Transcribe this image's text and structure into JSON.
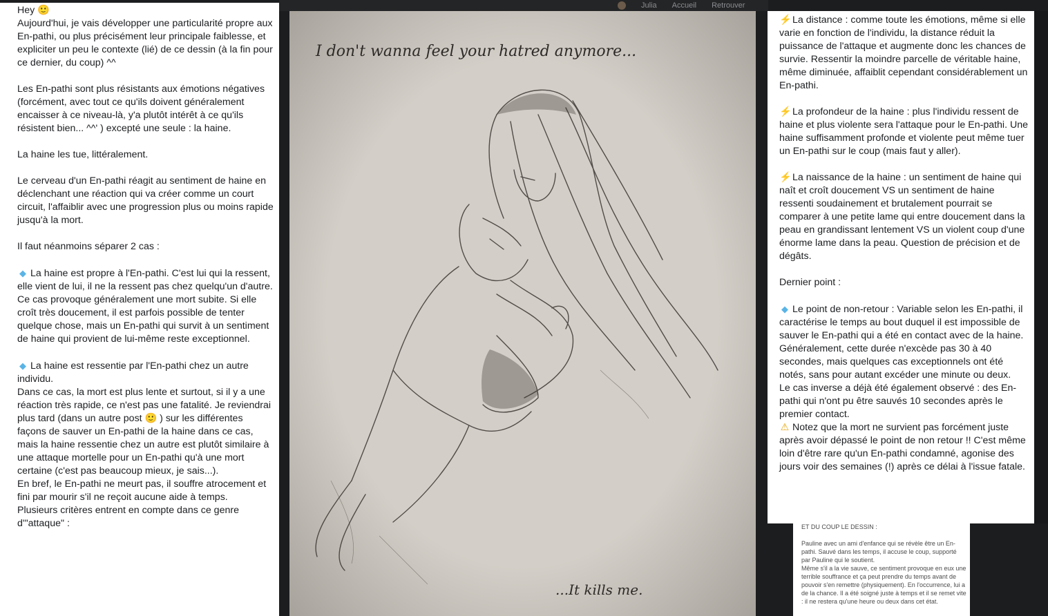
{
  "topbar": {
    "user": "Julia",
    "home": "Accueil",
    "other": "Retrouver"
  },
  "left": {
    "p1": "Hey 🙂\nAujourd'hui, je vais développer une particularité propre aux En-pathi, ou plus précisément leur principale faiblesse, et expliciter un peu le contexte (lié) de ce dessin (à la fin pour ce dernier, du coup) ^^",
    "p2": "Les En-pathi sont plus résistants aux émotions négatives (forcément, avec tout ce qu'ils doivent généralement encaisser à ce niveau-là, y'a plutôt intérêt à ce qu'ils résistent bien... ^^' ) excepté une seule : la haine.",
    "p3": "La haine les tue, littéralement.",
    "p4": "Le cerveau d'un En-pathi réagit au sentiment de haine en déclenchant une réaction qui va créer comme un court circuit, l'affaiblir avec une progression plus ou moins rapide jusqu'à la mort.",
    "p5": "Il faut néanmoins séparer 2 cas :",
    "p6": "La haine est propre à l'En-pathi. C'est lui qui la ressent, elle vient de lui, il ne la ressent pas chez quelqu'un d'autre.\nCe cas provoque généralement une mort subite. Si elle croît très doucement, il est parfois possible de tenter quelque chose, mais un En-pathi qui survit à un sentiment de haine qui provient de lui-même reste exceptionnel.",
    "p7": "La haine est ressentie par l'En-pathi chez un autre individu.\nDans ce cas, la mort est plus lente et surtout, si il y a une réaction très rapide, ce n'est pas une fatalité. Je reviendrai plus tard (dans un autre post 🙂 ) sur les différentes façons de sauver un En-pathi de la haine dans ce cas, mais la haine ressentie chez un autre est plutôt similaire à une attaque mortelle pour un En-pathi qu'à une mort certaine (c'est pas beaucoup mieux, je sais...).\nEn bref, le En-pathi ne meurt pas, il souffre atrocement et fini par mourir s'il ne reçoit aucune aide à temps.\nPlusieurs critères entrent en compte dans ce genre d'\"attaque\" :"
  },
  "image": {
    "caption_top": "I don't wanna feel your hatred anymore...",
    "caption_bottom": "...It kills me."
  },
  "right": {
    "p1": "La distance : comme toute les émotions, même si elle varie en fonction de l'individu, la distance réduit la puissance de l'attaque et augmente donc les chances de survie. Ressentir la moindre parcelle de véritable haine, même diminuée, affaiblit cependant considérablement un En-pathi.",
    "p2": "La profondeur de la haine : plus l'individu ressent de haine et plus violente sera l'attaque pour le En-pathi. Une haine suffisamment profonde et violente peut même tuer un En-pathi sur le coup (mais faut y aller).",
    "p3": "La naissance de la haine : un sentiment de haine qui naît et croît doucement VS un sentiment de haine ressenti soudainement et brutalement pourrait se comparer à une petite lame qui entre doucement dans la peau en grandissant lentement VS un violent coup d'une énorme lame dans la peau. Question de précision et de dégâts.",
    "p4": "Dernier point :",
    "p5": "Le point de non-retour : Variable selon les En-pathi, il caractérise le temps au bout duquel il est impossible de sauver le En-pathi qui a été en contact avec de la haine. Généralement, cette durée n'excède pas 30 à 40 secondes, mais quelques cas exceptionnels ont été notés, sans pour autant excéder une minute ou deux.\nLe cas inverse a déjà été également observé : des En-pathi qui n'ont pu être sauvés 10 secondes après le premier contact.",
    "p6": "Notez que la mort ne survient pas forcément juste après avoir dépassé le point de non retour !! C'est même loin d'être rare qu'un En-pathi condamné, agonise des jours voir des semaines (!) après ce délai à l'issue fatale."
  },
  "note": {
    "heading": "ET DU COUP LE DESSIN :",
    "body": "Pauline avec un ami d'enfance qui se révèle être un En-pathi. Sauvé dans les temps, il accuse le coup, supporté par Pauline qui le soutient.\nMême s'il a la vie sauve, ce sentiment provoque en eux une terrible souffrance et ça peut prendre du temps avant de pouvoir s'en remettre (physiquement). En l'occurrence, lui a de la chance. Il a été soigné juste à temps et il se remet vite : il ne restera qu'une heure ou deux dans cet état."
  }
}
